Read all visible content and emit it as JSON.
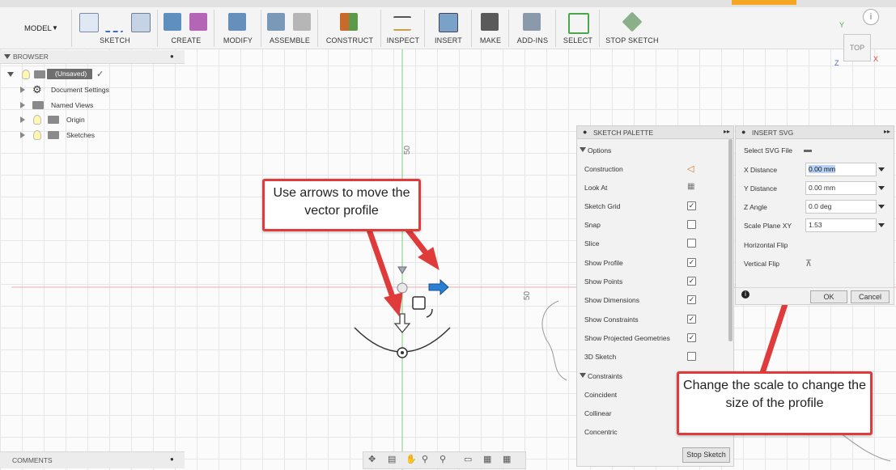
{
  "toolbar": {
    "workspace": "MODEL",
    "groups": [
      "SKETCH",
      "CREATE",
      "MODIFY",
      "ASSEMBLE",
      "CONSTRUCT",
      "INSPECT",
      "INSERT",
      "MAKE",
      "ADD-INS",
      "SELECT",
      "STOP SKETCH"
    ]
  },
  "browser": {
    "title": "BROWSER",
    "items": [
      "(Unsaved)",
      "Document Settings",
      "Named Views",
      "Origin",
      "Sketches"
    ]
  },
  "comments": {
    "title": "COMMENTS"
  },
  "viewcube": {
    "face": "TOP",
    "axis_x": "X",
    "axis_y": "Y",
    "axis_z": "Z"
  },
  "canvas": {
    "axis_label_vertical": "50",
    "axis_label_horizontal": "50"
  },
  "sketch_palette": {
    "title": "SKETCH PALETTE",
    "options_header": "Options",
    "options": [
      {
        "label": "Construction",
        "control": "icon"
      },
      {
        "label": "Look At",
        "control": "icon"
      },
      {
        "label": "Sketch Grid",
        "checked": true
      },
      {
        "label": "Snap",
        "checked": false
      },
      {
        "label": "Slice",
        "checked": false
      },
      {
        "label": "Show Profile",
        "checked": true
      },
      {
        "label": "Show Points",
        "checked": true
      },
      {
        "label": "Show Dimensions",
        "checked": true
      },
      {
        "label": "Show Constraints",
        "checked": true
      },
      {
        "label": "Show Projected Geometries",
        "checked": true
      },
      {
        "label": "3D Sketch",
        "checked": false
      }
    ],
    "constraints_header": "Constraints",
    "constraints": [
      "Coincident",
      "Collinear",
      "Concentric"
    ],
    "stop_button": "Stop Sketch"
  },
  "insert_svg": {
    "title": "INSERT SVG",
    "select_file_label": "Select SVG File",
    "fields": [
      {
        "label": "X Distance",
        "value": "0.00 mm"
      },
      {
        "label": "Y Distance",
        "value": "0.00 mm"
      },
      {
        "label": "Z Angle",
        "value": "0.0 deg"
      },
      {
        "label": "Scale Plane XY",
        "value": "1.53"
      }
    ],
    "horizontal_flip_label": "Horizontal Flip",
    "vertical_flip_label": "Vertical Flip",
    "ok_label": "OK",
    "cancel_label": "Cancel"
  },
  "callouts": {
    "move": "Use arrows to move the vector profile",
    "scale": "Change the scale to change the size of the profile"
  },
  "colors": {
    "annotation_red": "#e03b3b",
    "move_arrow_blue": "#2a7fd4"
  }
}
